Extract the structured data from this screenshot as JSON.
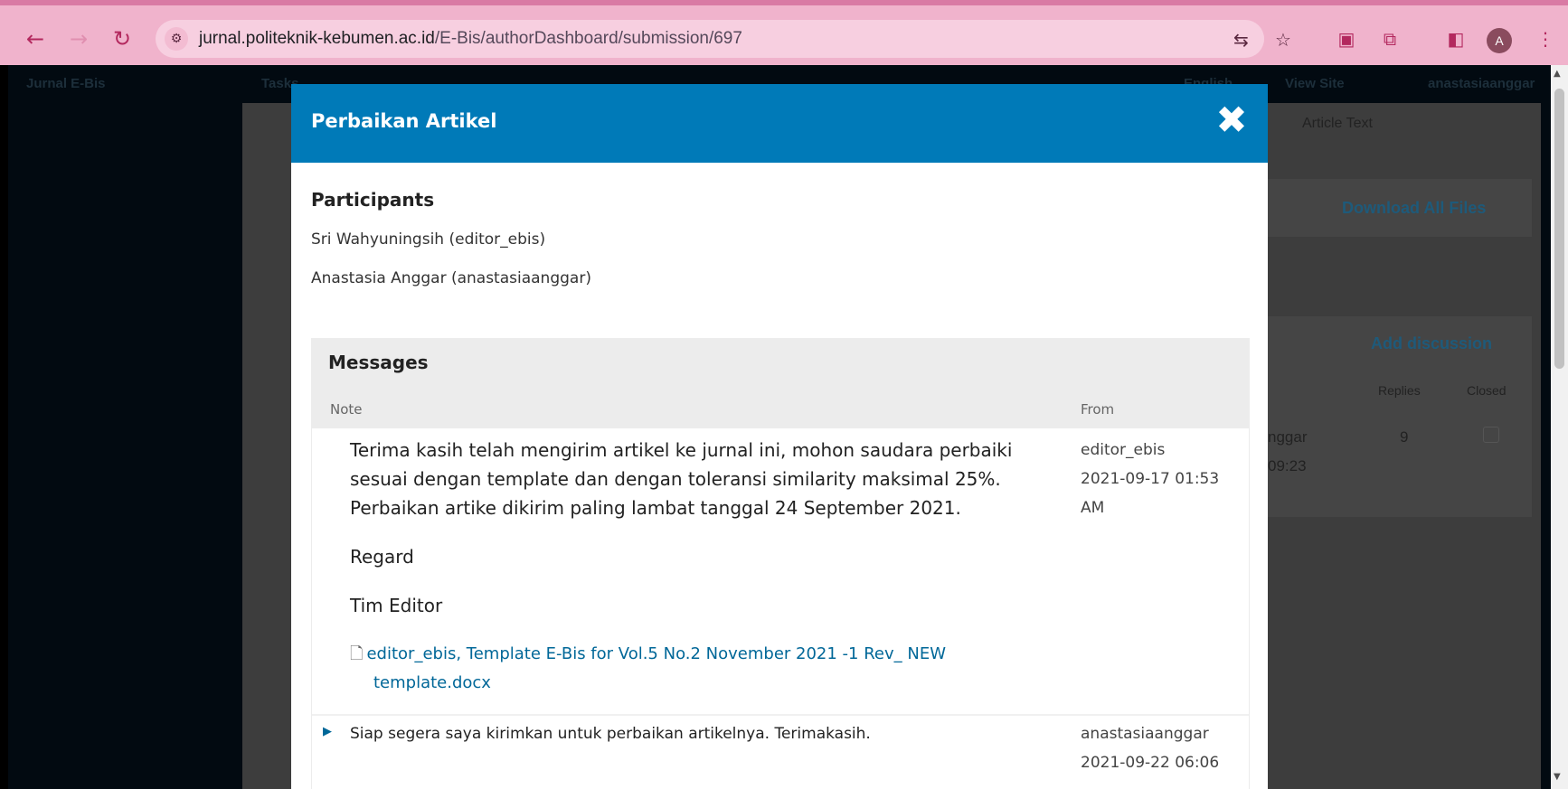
{
  "browser": {
    "url_domain": "jurnal.politeknik-kebumen.ac.id",
    "url_path": "/E-Bis/authorDashboard/submission/697",
    "avatar_letter": "A",
    "icons": [
      "back-icon",
      "forward-icon",
      "reload-icon",
      "site-settings-icon",
      "translate-icon",
      "star-icon",
      "pocket-icon",
      "extensions-icon",
      "side-panel-icon",
      "menu-icon"
    ]
  },
  "app_bar": {
    "journal": "Jurnal E-Bis",
    "tasks": "Tasks",
    "language": "English",
    "view_site": "View Site",
    "user": "anastasiaanggar"
  },
  "background": {
    "tab_article_text": "Article Text",
    "download_all": "Download All Files",
    "add_discussion": "Add discussion",
    "col_replies": "Replies",
    "col_closed": "Closed",
    "row_from_partial": "nggar",
    "row_time_partial": "09:23",
    "row_replies": "9"
  },
  "modal": {
    "title": "Perbaikan Artikel",
    "close_glyph": "✖",
    "participants_title": "Participants",
    "participants": [
      "Sri Wahyuningsih (editor_ebis)",
      "Anastasia Anggar (anastasiaanggar)"
    ],
    "messages_title": "Messages",
    "col_note": "Note",
    "col_from": "From",
    "messages": [
      {
        "lines": [
          "Terima kasih telah mengirim artikel ke jurnal ini, mohon saudara perbaiki",
          "sesuai dengan template dan dengan toleransi similarity maksimal 25%.",
          "Perbaikan artike dikirim paling lambat tanggal 24 September 2021."
        ],
        "regard": "Regard",
        "signature": "Tim Editor",
        "file_line1": "editor_ebis, Template E-Bis for Vol.5 No.2 November 2021 -1 Rev_ NEW",
        "file_line2": "template.docx",
        "from": "editor_ebis",
        "date": "2021-09-17 01:53",
        "time_suffix": "AM"
      },
      {
        "text": "Siap segera saya kirimkan untuk perbaikan artikelnya. Terimakasih.",
        "from": "anastasiaanggar",
        "date": "2021-09-22 06:06"
      }
    ]
  }
}
